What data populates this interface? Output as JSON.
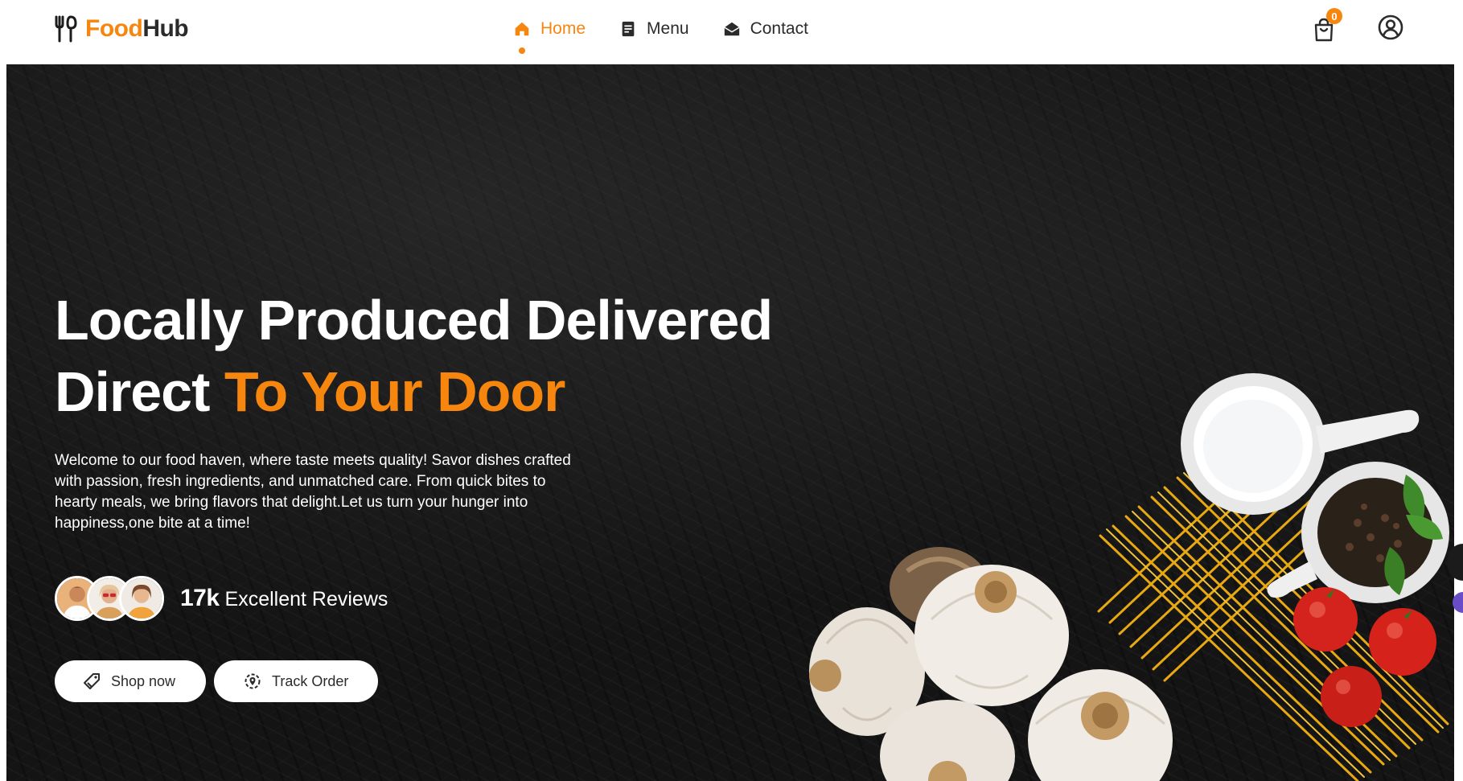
{
  "brand": {
    "name_part1": "Food",
    "name_part2": "Hub"
  },
  "nav": {
    "items": [
      {
        "label": "Home",
        "icon": "home-icon",
        "active": true
      },
      {
        "label": "Menu",
        "icon": "menu-doc-icon",
        "active": false
      },
      {
        "label": "Contact",
        "icon": "envelope-open-icon",
        "active": false
      }
    ]
  },
  "header": {
    "cart_count": "0",
    "cart_icon": "shopping-bag-icon",
    "account_icon": "user-circle-icon"
  },
  "hero": {
    "headline_part1": "Locally Produced Delivered",
    "headline_part2": "Direct",
    "headline_accent": "To Your Door",
    "intro": "Welcome to our food haven, where taste meets quality! Savor dishes crafted with passion, fresh ingredients, and unmatched care. From quick bites to hearty meals, we bring flavors that delight.Let us turn your hunger into happiness,one bite at a time!",
    "reviews_count": "17k",
    "reviews_label": "Excellent Reviews",
    "shop_button": "Shop now",
    "track_button": "Track Order"
  },
  "colors": {
    "accent": "#f7860f",
    "text_dark": "#2b2b2b",
    "hero_bg": "#141414"
  }
}
